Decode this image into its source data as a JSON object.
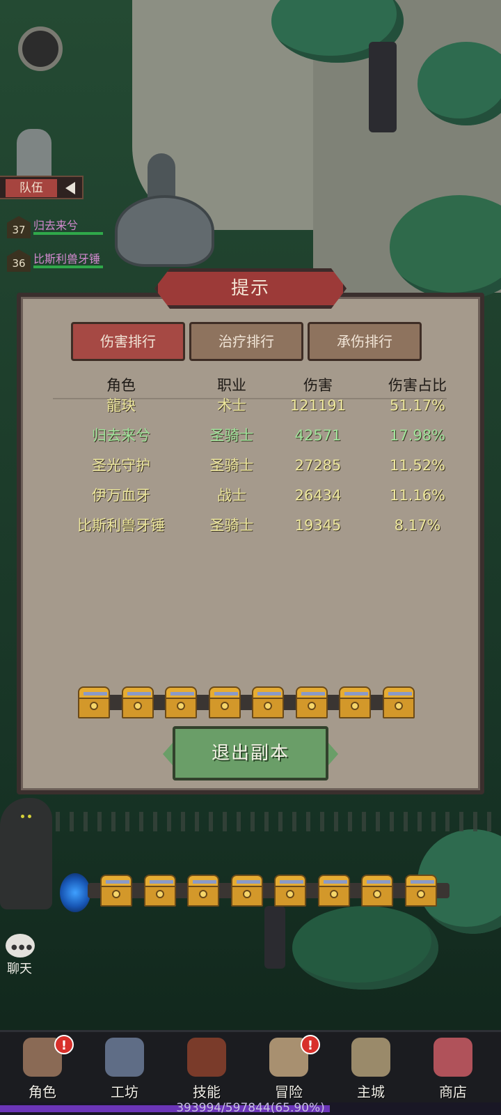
{
  "team": {
    "tab_label": "队伍",
    "members": [
      {
        "level": "37",
        "name": "归去来兮"
      },
      {
        "level": "36",
        "name": "比斯利兽牙锤"
      }
    ]
  },
  "modal": {
    "title": "提示",
    "tabs": [
      {
        "label": "伤害排行",
        "active": true
      },
      {
        "label": "治疗排行",
        "active": false
      },
      {
        "label": "承伤排行",
        "active": false
      }
    ],
    "columns": [
      "角色",
      "职业",
      "伤害",
      "伤害占比"
    ],
    "rows": [
      {
        "name": "龍玦",
        "class": "术士",
        "damage": "121191",
        "percent": "51.17%",
        "color": "#ece69c"
      },
      {
        "name": "归去来兮",
        "class": "圣骑士",
        "damage": "42571",
        "percent": "17.98%",
        "color": "#9fe39a"
      },
      {
        "name": "圣光守护",
        "class": "圣骑士",
        "damage": "27285",
        "percent": "11.52%",
        "color": "#ece69c"
      },
      {
        "name": "伊万血牙",
        "class": "战士",
        "damage": "26434",
        "percent": "11.16%",
        "color": "#ece69c"
      },
      {
        "name": "比斯利兽牙锤",
        "class": "圣骑士",
        "damage": "19345",
        "percent": "8.17%",
        "color": "#ece69c"
      }
    ],
    "chest_count": 8,
    "exit_label": "退出副本"
  },
  "scene": {
    "bottom_chest_count": 8
  },
  "chat": {
    "label": "聊天"
  },
  "nav": {
    "items": [
      {
        "label": "角色",
        "icon": "character-icon",
        "badge": "!"
      },
      {
        "label": "工坊",
        "icon": "anvil-icon",
        "badge": ""
      },
      {
        "label": "技能",
        "icon": "skill-book-icon",
        "badge": ""
      },
      {
        "label": "冒险",
        "icon": "map-scroll-icon",
        "badge": "!"
      },
      {
        "label": "主城",
        "icon": "castle-icon",
        "badge": ""
      },
      {
        "label": "商店",
        "icon": "shop-icon",
        "badge": ""
      }
    ]
  },
  "xp": {
    "text": "393994/597844(65.90%)",
    "fraction": 0.659
  }
}
